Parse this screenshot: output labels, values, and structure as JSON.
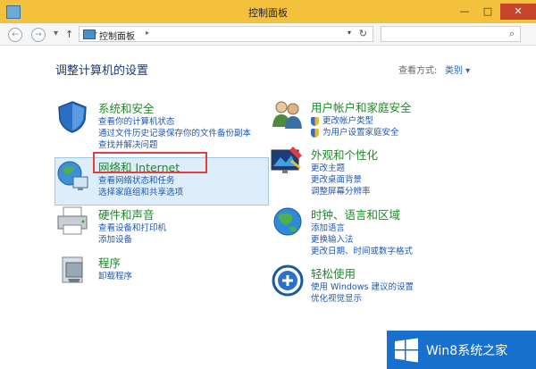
{
  "window": {
    "title": "控制面板",
    "minimize": "—",
    "maximize": "□",
    "close": "✕"
  },
  "address": {
    "crumb": "控制面板",
    "sep1": "▸",
    "sep2": "▸"
  },
  "search": {
    "placeholder": ""
  },
  "heading": "调整计算机的设置",
  "view_by": {
    "label": "查看方式:",
    "value": "类别 ▾"
  },
  "categories": [
    {
      "title": "系统和安全",
      "links": [
        "查看你的计算机状态",
        "通过文件历史记录保存你的文件备份副本",
        "查找并解决问题"
      ]
    },
    {
      "title": "网络和 Internet",
      "links": [
        "查看网络状态和任务",
        "选择家庭组和共享选项"
      ]
    },
    {
      "title": "硬件和声音",
      "links": [
        "查看设备和打印机",
        "添加设备"
      ]
    },
    {
      "title": "程序",
      "links": [
        "卸载程序"
      ]
    },
    {
      "title": "用户帐户和家庭安全",
      "links": [
        "更改帐户类型",
        "为用户设置家庭安全"
      ]
    },
    {
      "title": "外观和个性化",
      "links": [
        "更改主题",
        "更改桌面背景",
        "调整屏幕分辨率"
      ]
    },
    {
      "title": "时钟、语言和区域",
      "links": [
        "添加语言",
        "更换输入法",
        "更改日期、时间或数字格式"
      ]
    },
    {
      "title": "轻松使用",
      "links": [
        "使用 Windows 建议的设置",
        "优化视觉显示"
      ]
    }
  ],
  "brand": {
    "text": "Win8系统之家"
  },
  "colors": {
    "titlebar": "#f3c13b",
    "category_title": "#1d8a2a",
    "link": "#1f57b6",
    "highlight": "#ddeefa",
    "annotation": "#e33d3d",
    "brand": "#1771cc"
  }
}
